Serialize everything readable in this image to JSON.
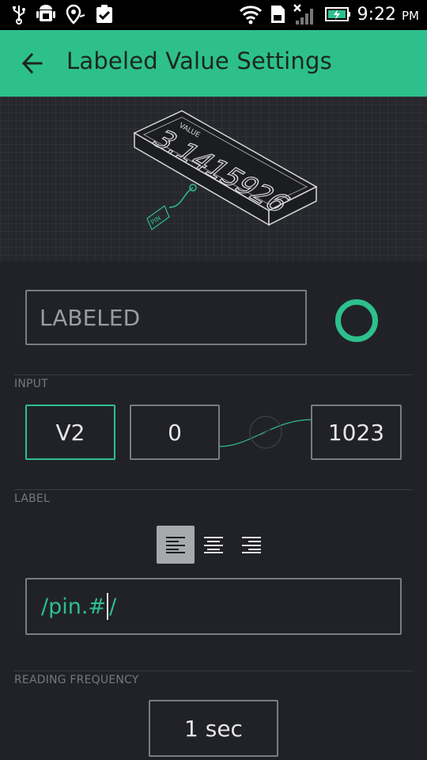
{
  "status_bar": {
    "time": "9:22",
    "ampm": "PM",
    "icons": [
      "usb-icon",
      "android-debug-icon",
      "location-icon",
      "clipboard-check-icon",
      "wifi-icon",
      "sd-card-icon",
      "no-signal-icon",
      "battery-charging-icon"
    ]
  },
  "app_bar": {
    "title": "Labeled Value Settings",
    "back_icon": "back-arrow-icon"
  },
  "preview": {
    "value_label": "VALUE",
    "value": "3.1415926",
    "pin_label": "PIN"
  },
  "widget": {
    "name_placeholder": "LABELED",
    "accent_color": "#2dc08d"
  },
  "input": {
    "section_label": "INPUT",
    "pin": "V2",
    "min": "0",
    "max": "1023"
  },
  "label": {
    "section_label": "LABEL",
    "alignment": "left",
    "format_before_cursor": "/pin.#",
    "format_after_cursor": "/"
  },
  "reading_frequency": {
    "section_label": "READING FREQUENCY",
    "value": "1 sec"
  }
}
